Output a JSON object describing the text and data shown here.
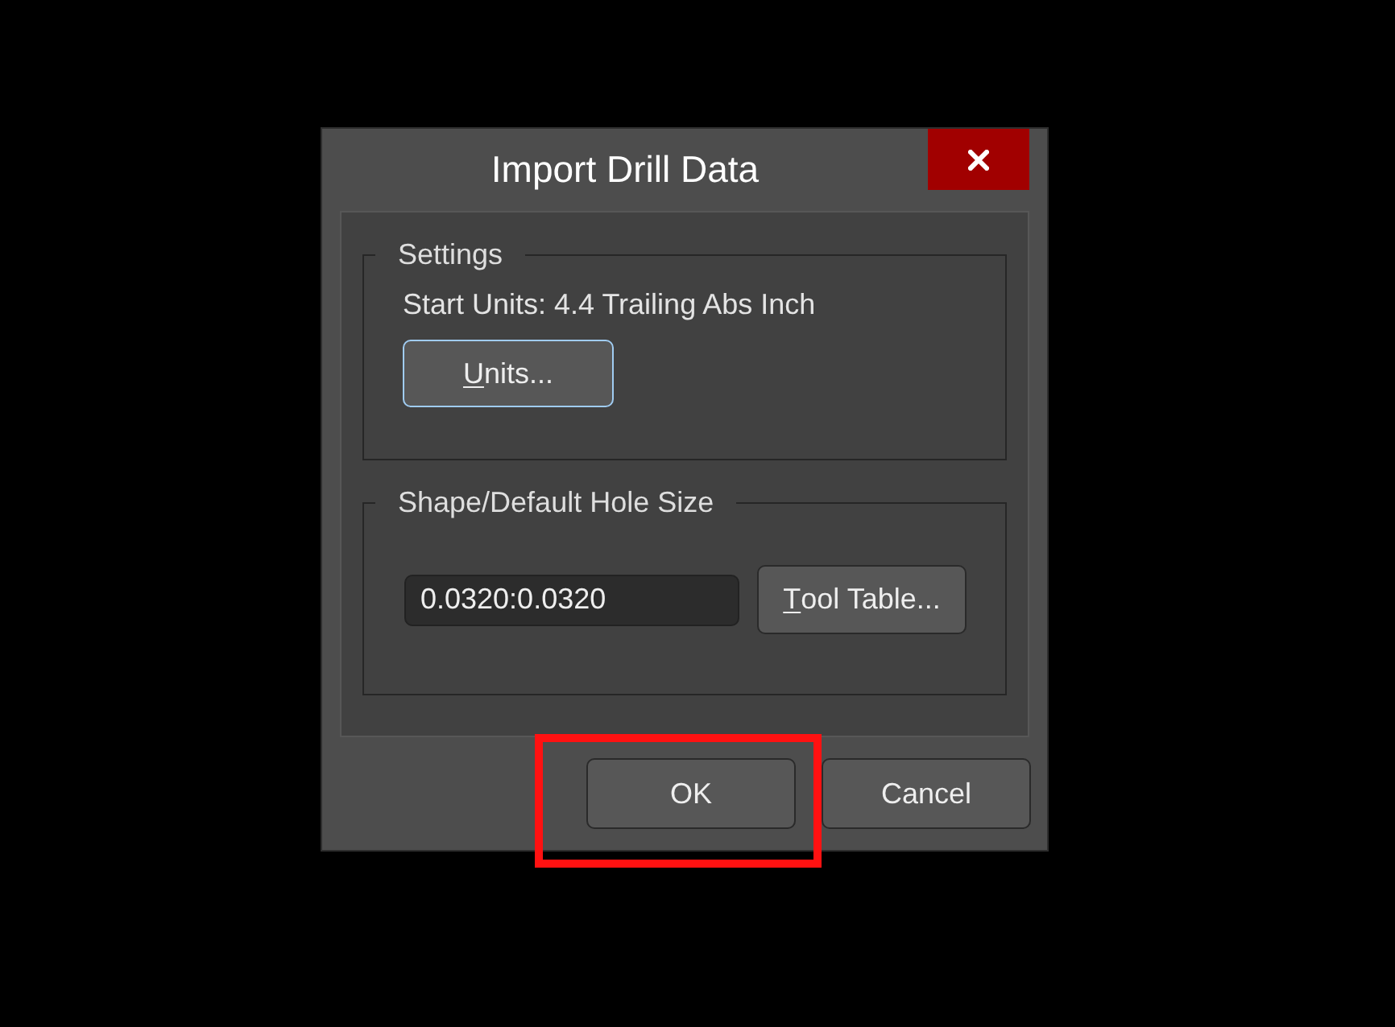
{
  "window": {
    "title": "Import Drill Data"
  },
  "groups": [
    {
      "kind": "settings",
      "legend": "Settings",
      "text": "Start Units: 4.4 Trailing Abs Inch",
      "button": {
        "label": "Units...",
        "underline_first_letter": true,
        "focused": true
      }
    },
    {
      "kind": "hole_size",
      "legend": "Shape/Default Hole Size",
      "field": {
        "value": "0.0320:0.0320"
      },
      "button": {
        "label": "Tool Table...",
        "underline_first_letter": true,
        "focused": false
      }
    }
  ],
  "buttons": [
    {
      "label": "OK",
      "highlighted": true
    },
    {
      "label": "Cancel",
      "highlighted": false
    }
  ]
}
